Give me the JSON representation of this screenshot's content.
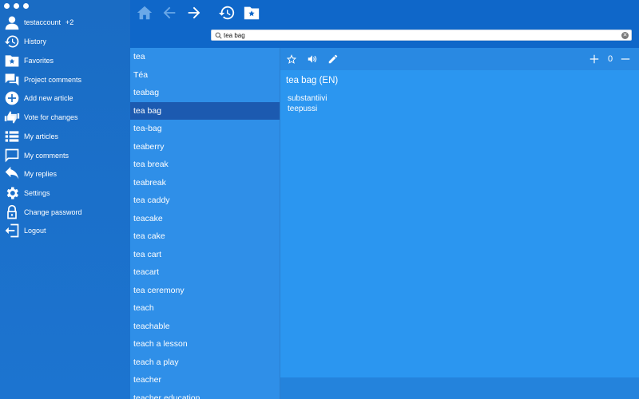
{
  "sidebar": {
    "items": [
      {
        "label": "testaccount",
        "icon": "user-icon",
        "badge": "+2"
      },
      {
        "label": "History",
        "icon": "history-icon"
      },
      {
        "label": "Favorites",
        "icon": "favorites-icon"
      },
      {
        "label": "Project comments",
        "icon": "comments-icon"
      },
      {
        "label": "Add new article",
        "icon": "add-icon"
      },
      {
        "label": "Vote for changes",
        "icon": "vote-icon"
      },
      {
        "label": "My articles",
        "icon": "list-icon"
      },
      {
        "label": "My comments",
        "icon": "comment-icon"
      },
      {
        "label": "My replies",
        "icon": "reply-icon"
      },
      {
        "label": "Settings",
        "icon": "gear-icon"
      },
      {
        "label": "Change password",
        "icon": "lock-icon"
      },
      {
        "label": "Logout",
        "icon": "logout-icon"
      }
    ]
  },
  "search": {
    "value": "tea bag",
    "placeholder": ""
  },
  "wordlist": {
    "items": [
      "tea",
      "Téa",
      "teabag",
      "tea bag",
      "tea-bag",
      "teaberry",
      "tea break",
      "teabreak",
      "tea caddy",
      "teacake",
      "tea cake",
      "tea cart",
      "teacart",
      "tea ceremony",
      "teach",
      "teachable",
      "teach a lesson",
      "teach a play",
      "teacher",
      "teacher education"
    ],
    "selected": "tea bag"
  },
  "article": {
    "title": "tea bag (EN)",
    "part_of_speech": "substantiivi",
    "translation": "teepussi",
    "zoom": "0"
  },
  "colors": {
    "sidebar": "#1a6cc4",
    "topbar": "#0f67c9",
    "list": "#2f8fe8",
    "selected": "#1c5ab0",
    "article": "#2b96f0"
  }
}
